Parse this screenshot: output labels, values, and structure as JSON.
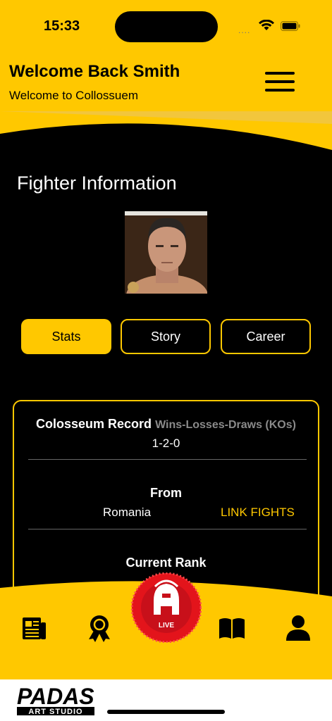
{
  "status": {
    "time": "15:33",
    "signal": "....",
    "icons": [
      "wifi-icon",
      "battery-icon"
    ]
  },
  "header": {
    "title": "Welcome Back Smith",
    "subtitle": "Welcome to Collossuem",
    "menu_icon": "hamburger-menu-icon"
  },
  "section": {
    "title": "Fighter Information"
  },
  "tabs": [
    {
      "label": "Stats",
      "active": true
    },
    {
      "label": "Story",
      "active": false
    },
    {
      "label": "Career",
      "active": false
    }
  ],
  "card": {
    "record_label": "Colosseum Record",
    "record_sub": "Wins-Losses-Draws (KOs)",
    "record_value": "1-2-0",
    "from_label": "From",
    "from_value": "Romania",
    "link_label": "LINK FIGHTS",
    "rank_label": "Current Rank"
  },
  "nav": {
    "items": [
      "news-icon",
      "award-icon",
      "live-icon",
      "book-icon",
      "profile-icon"
    ],
    "live_label": "LIVE"
  },
  "footer": {
    "logo_text": "PADAS",
    "logo_sub": "ART STUDIO"
  },
  "colors": {
    "accent": "#FFC800",
    "live": "#E3141B",
    "background": "#000000"
  }
}
